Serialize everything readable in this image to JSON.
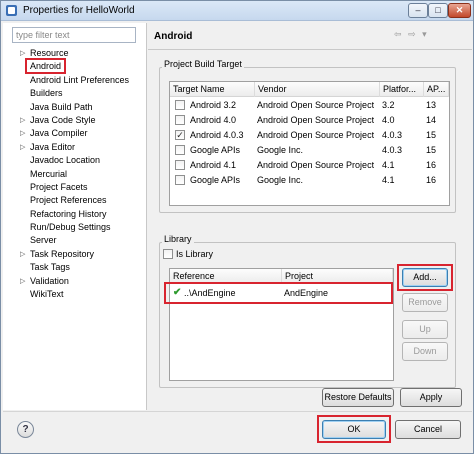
{
  "window": {
    "title": "Properties for HelloWorld",
    "controls": {
      "minimize": "–",
      "maximize": "□",
      "close": "✕"
    }
  },
  "left": {
    "filter_placeholder": "type filter text",
    "tree": [
      {
        "label": "Resource",
        "expandable": true
      },
      {
        "label": "Android",
        "expandable": false,
        "selected": true
      },
      {
        "label": "Android Lint Preferences",
        "expandable": false
      },
      {
        "label": "Builders",
        "expandable": false
      },
      {
        "label": "Java Build Path",
        "expandable": false
      },
      {
        "label": "Java Code Style",
        "expandable": true
      },
      {
        "label": "Java Compiler",
        "expandable": true
      },
      {
        "label": "Java Editor",
        "expandable": true
      },
      {
        "label": "Javadoc Location",
        "expandable": false
      },
      {
        "label": "Mercurial",
        "expandable": false
      },
      {
        "label": "Project Facets",
        "expandable": false
      },
      {
        "label": "Project References",
        "expandable": false
      },
      {
        "label": "Refactoring History",
        "expandable": false
      },
      {
        "label": "Run/Debug Settings",
        "expandable": false
      },
      {
        "label": "Server",
        "expandable": false
      },
      {
        "label": "Task Repository",
        "expandable": true
      },
      {
        "label": "Task Tags",
        "expandable": false
      },
      {
        "label": "Validation",
        "expandable": true
      },
      {
        "label": "WikiText",
        "expandable": false
      }
    ]
  },
  "page": {
    "title": "Android",
    "nav": {
      "back": "⇦",
      "forward": "⇨",
      "menu": "▾"
    },
    "build_target": {
      "group_label": "Project Build Target",
      "columns": [
        "Target Name",
        "Vendor",
        "Platfor...",
        "AP..."
      ],
      "rows": [
        {
          "checked": false,
          "name": "Android 3.2",
          "vendor": "Android Open Source Project",
          "platform": "3.2",
          "api": "13"
        },
        {
          "checked": false,
          "name": "Android 4.0",
          "vendor": "Android Open Source Project",
          "platform": "4.0",
          "api": "14"
        },
        {
          "checked": true,
          "name": "Android 4.0.3",
          "vendor": "Android Open Source Project",
          "platform": "4.0.3",
          "api": "15"
        },
        {
          "checked": false,
          "name": "Google APIs",
          "vendor": "Google Inc.",
          "platform": "4.0.3",
          "api": "15"
        },
        {
          "checked": false,
          "name": "Android 4.1",
          "vendor": "Android Open Source Project",
          "platform": "4.1",
          "api": "16"
        },
        {
          "checked": false,
          "name": "Google APIs",
          "vendor": "Google Inc.",
          "platform": "4.1",
          "api": "16"
        }
      ]
    },
    "library": {
      "group_label": "Library",
      "is_library_label": "Is Library",
      "is_library_checked": false,
      "columns": [
        "Reference",
        "Project"
      ],
      "rows": [
        {
          "reference": "..\\AndEngine",
          "project": "AndEngine"
        }
      ],
      "buttons": {
        "add": "Add...",
        "remove": "Remove",
        "up": "Up",
        "down": "Down"
      }
    },
    "restore_defaults": "Restore Defaults",
    "apply": "Apply"
  },
  "footer": {
    "help": "?",
    "ok": "OK",
    "cancel": "Cancel"
  },
  "colors": {
    "highlight_red": "#d8242f",
    "check_green": "#2e9b2e"
  }
}
